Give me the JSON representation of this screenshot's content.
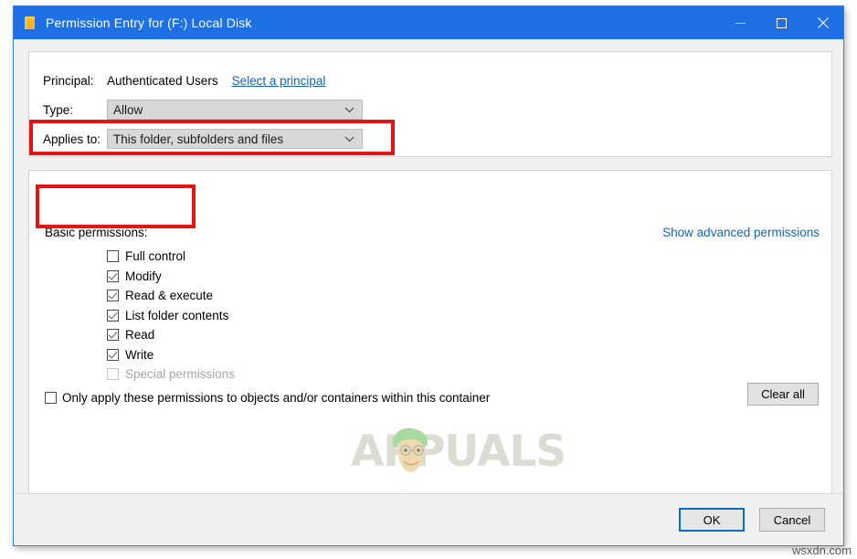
{
  "window": {
    "title": "Permission Entry for (F:) Local Disk",
    "icon": "folder-icon",
    "controls": {
      "minimize": "minimize-icon",
      "maximize": "maximize-icon",
      "close": "close-icon"
    }
  },
  "top_panel": {
    "principal_label": "Principal:",
    "principal_value": "Authenticated Users",
    "select_principal_link": "Select a principal",
    "type_label": "Type:",
    "type_value": "Allow",
    "applies_to_label": "Applies to:",
    "applies_to_value": "This folder, subfolders and files"
  },
  "main_panel": {
    "basic_permissions_label": "Basic permissions:",
    "show_advanced_link": "Show advanced permissions",
    "permissions": [
      {
        "label": "Full control",
        "checked": false,
        "disabled": false
      },
      {
        "label": "Modify",
        "checked": true,
        "disabled": false
      },
      {
        "label": "Read & execute",
        "checked": true,
        "disabled": false
      },
      {
        "label": "List folder contents",
        "checked": true,
        "disabled": false
      },
      {
        "label": "Read",
        "checked": true,
        "disabled": false
      },
      {
        "label": "Write",
        "checked": true,
        "disabled": false
      },
      {
        "label": "Special permissions",
        "checked": false,
        "disabled": true
      }
    ],
    "only_apply_label": "Only apply these permissions to objects and/or containers within this container",
    "only_apply_checked": false,
    "clear_all_label": "Clear all"
  },
  "footer": {
    "ok_label": "OK",
    "cancel_label": "Cancel"
  },
  "watermarks": {
    "center": "APPUALS",
    "corner": "wsxdn.com"
  },
  "colors": {
    "titlebar": "#1f6fe5",
    "link": "#1464b4",
    "annotation": "#e81212",
    "focus_border": "#0a6cc4"
  }
}
